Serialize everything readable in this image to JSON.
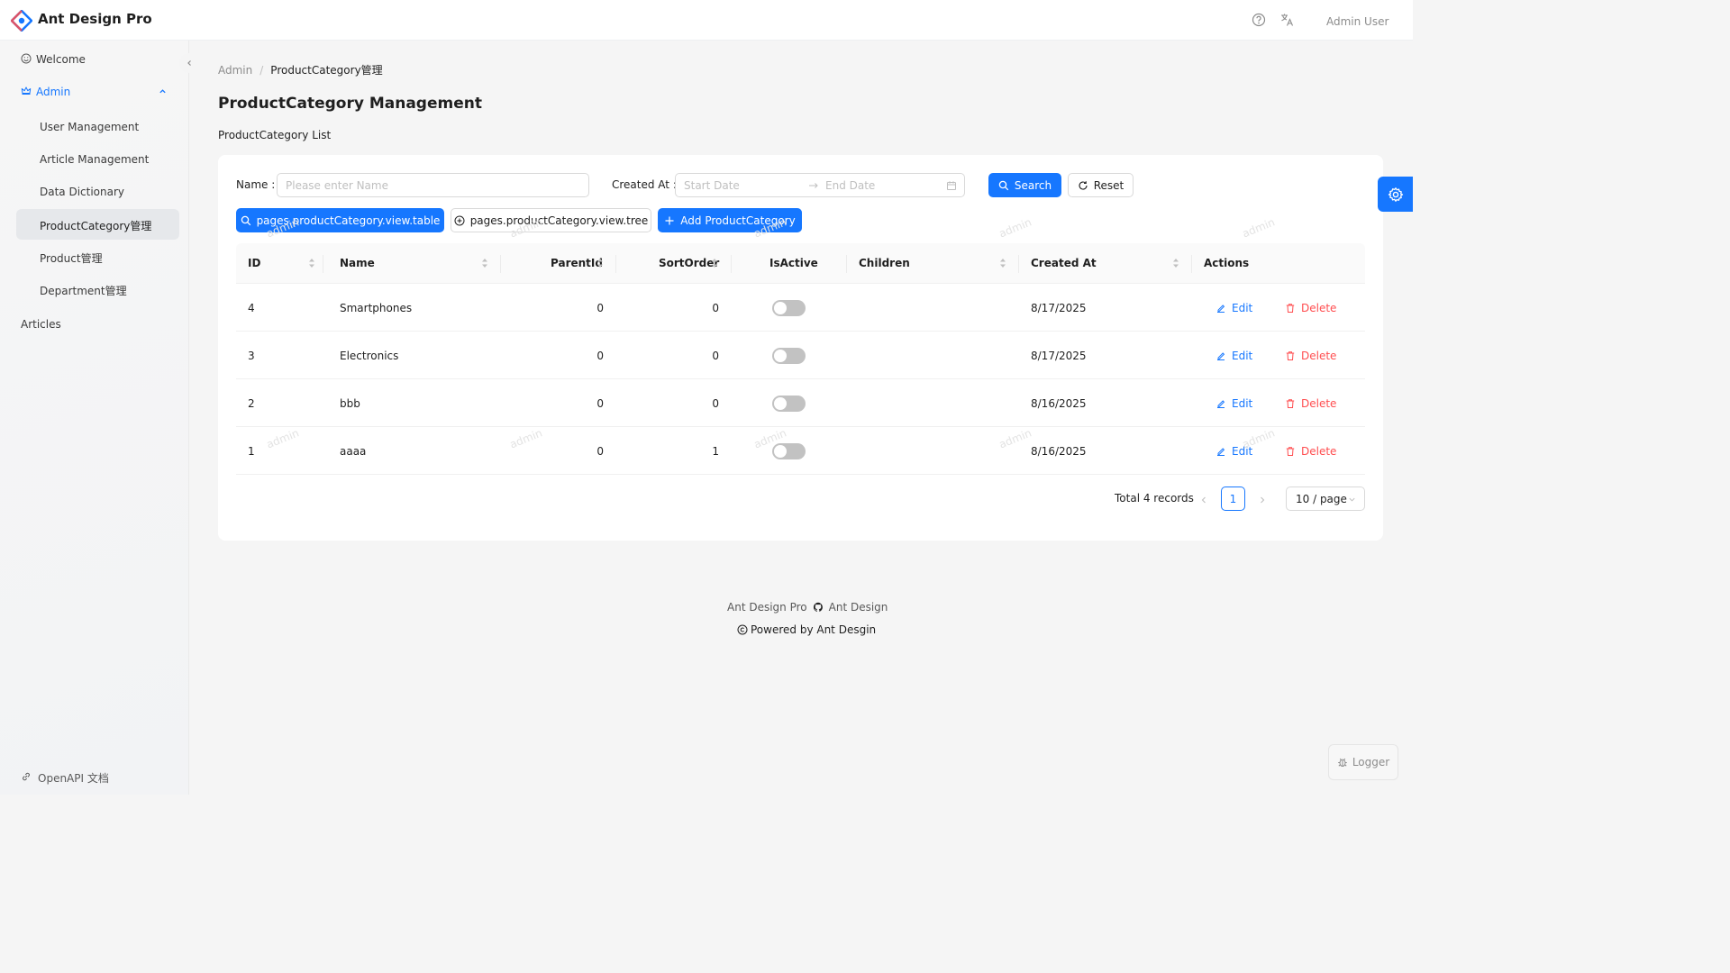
{
  "header": {
    "brand": "Ant Design Pro",
    "user": "Admin User",
    "icons": [
      "question-circle-icon",
      "translate-icon"
    ]
  },
  "sidebar": {
    "items": [
      {
        "label": "Welcome",
        "icon": "smile-icon"
      },
      {
        "label": "Admin",
        "icon": "crown-icon",
        "expanded": true
      }
    ],
    "sub_items": [
      {
        "label": "User Management"
      },
      {
        "label": "Article Management"
      },
      {
        "label": "Data Dictionary"
      },
      {
        "label": "ProductCategory管理",
        "active": true
      },
      {
        "label": "Product管理"
      },
      {
        "label": "Department管理"
      }
    ],
    "articles": "Articles",
    "footer_link": "OpenAPI 文档"
  },
  "breadcrumb": {
    "parent": "Admin",
    "separator": "/",
    "current": "ProductCategory管理"
  },
  "page": {
    "title": "ProductCategory Management",
    "subtitle": "ProductCategory List"
  },
  "filters": {
    "name_label": "Name :",
    "name_placeholder": "Please enter Name",
    "created_label": "Created At :",
    "start_placeholder": "Start Date",
    "end_placeholder": "End Date",
    "search": "Search",
    "reset": "Reset"
  },
  "toolbar": {
    "table_view": "pages.productCategory.view.table",
    "tree_view": "pages.productCategory.view.tree",
    "add": "Add ProductCategory"
  },
  "table": {
    "columns": [
      "ID",
      "Name",
      "ParentId",
      "SortOrder",
      "IsActive",
      "Children",
      "Created At",
      "Actions"
    ],
    "rows": [
      {
        "id": "4",
        "name": "Smartphones",
        "parent_id": "0",
        "sort_order": "0",
        "is_active": false,
        "children": "",
        "created_at": "8/17/2025"
      },
      {
        "id": "3",
        "name": "Electronics",
        "parent_id": "0",
        "sort_order": "0",
        "is_active": false,
        "children": "",
        "created_at": "8/17/2025"
      },
      {
        "id": "2",
        "name": "bbb",
        "parent_id": "0",
        "sort_order": "0",
        "is_active": false,
        "children": "",
        "created_at": "8/16/2025"
      },
      {
        "id": "1",
        "name": "aaaa",
        "parent_id": "0",
        "sort_order": "1",
        "is_active": false,
        "children": "",
        "created_at": "8/16/2025"
      }
    ],
    "edit": "Edit",
    "delete": "Delete"
  },
  "pagination": {
    "total": "Total 4 records",
    "current": "1",
    "page_size": "10 / page"
  },
  "watermark": "admin",
  "footer": {
    "line1_left": "Ant Design Pro",
    "line1_right": "Ant Design",
    "line2": "Powered by Ant Desgin"
  },
  "logger": "Logger",
  "colors": {
    "primary": "#1677ff",
    "danger": "#ff4d4f",
    "bg": "#f5f5f5"
  }
}
